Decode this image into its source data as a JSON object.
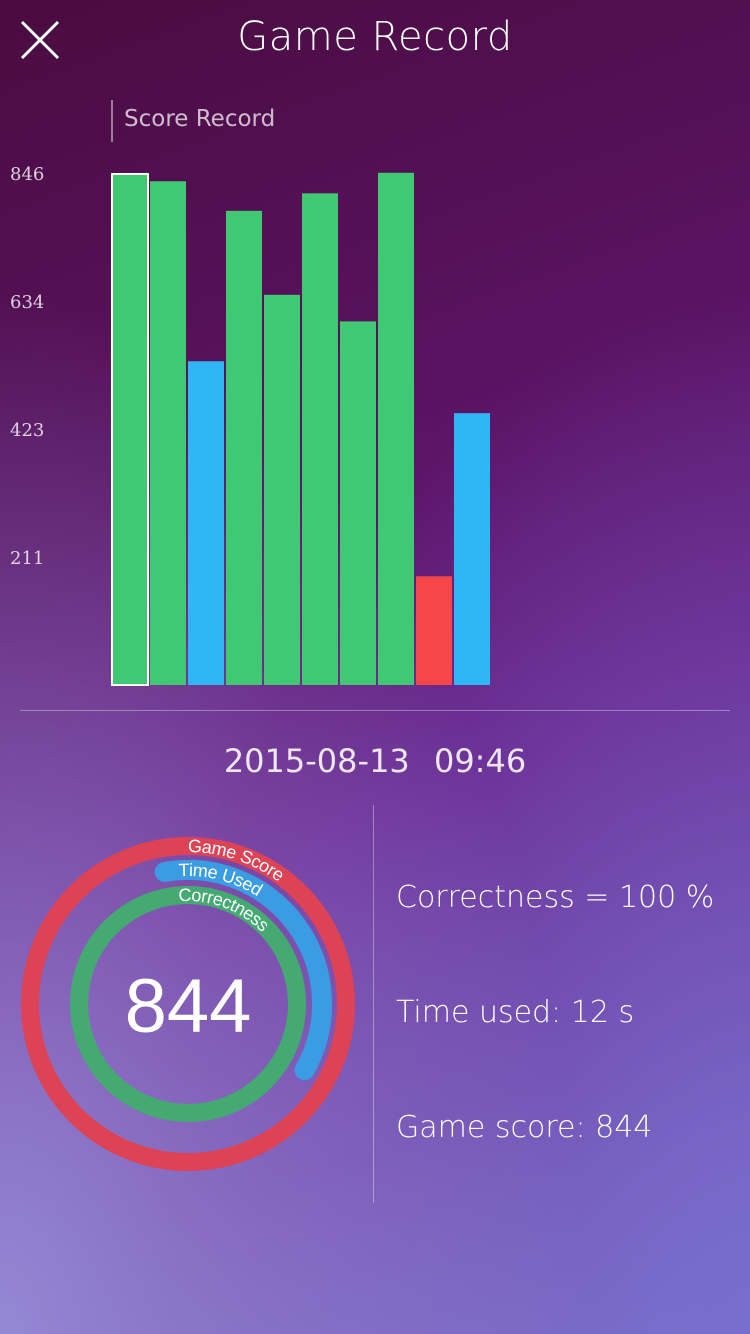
{
  "header": {
    "title": "Game Record",
    "close_icon": "close-icon"
  },
  "chart_data": {
    "type": "bar",
    "title": "",
    "legend": "Score Record",
    "yticks": [
      "846",
      "634",
      "423",
      "211"
    ],
    "ylim": [
      0,
      846
    ],
    "values": [
      846,
      834,
      536,
      785,
      646,
      814,
      602,
      848,
      180,
      450
    ],
    "bar_colors": [
      "#41c872",
      "#41c872",
      "#2fb6f5",
      "#41c872",
      "#41c872",
      "#41c872",
      "#41c872",
      "#41c872",
      "#f54649",
      "#2fb6f5"
    ],
    "selected_index": 0
  },
  "record": {
    "datetime": "2015-08-13   09:46"
  },
  "rings": {
    "score_value": "844",
    "labels": {
      "game_score": "Game Score",
      "time_used": "Time Used",
      "correctness": "Correctness"
    },
    "fractions": {
      "game_score": 1.0,
      "time_used": 0.36,
      "correctness": 1.0
    },
    "colors": {
      "game_score": "#de4255",
      "time_used": "#3a9ce3",
      "correctness": "#44aa72"
    }
  },
  "stats": {
    "correctness": "Correctness = 100 %",
    "time_used": "Time used: 12 s",
    "game_score": "Game score: 844"
  }
}
